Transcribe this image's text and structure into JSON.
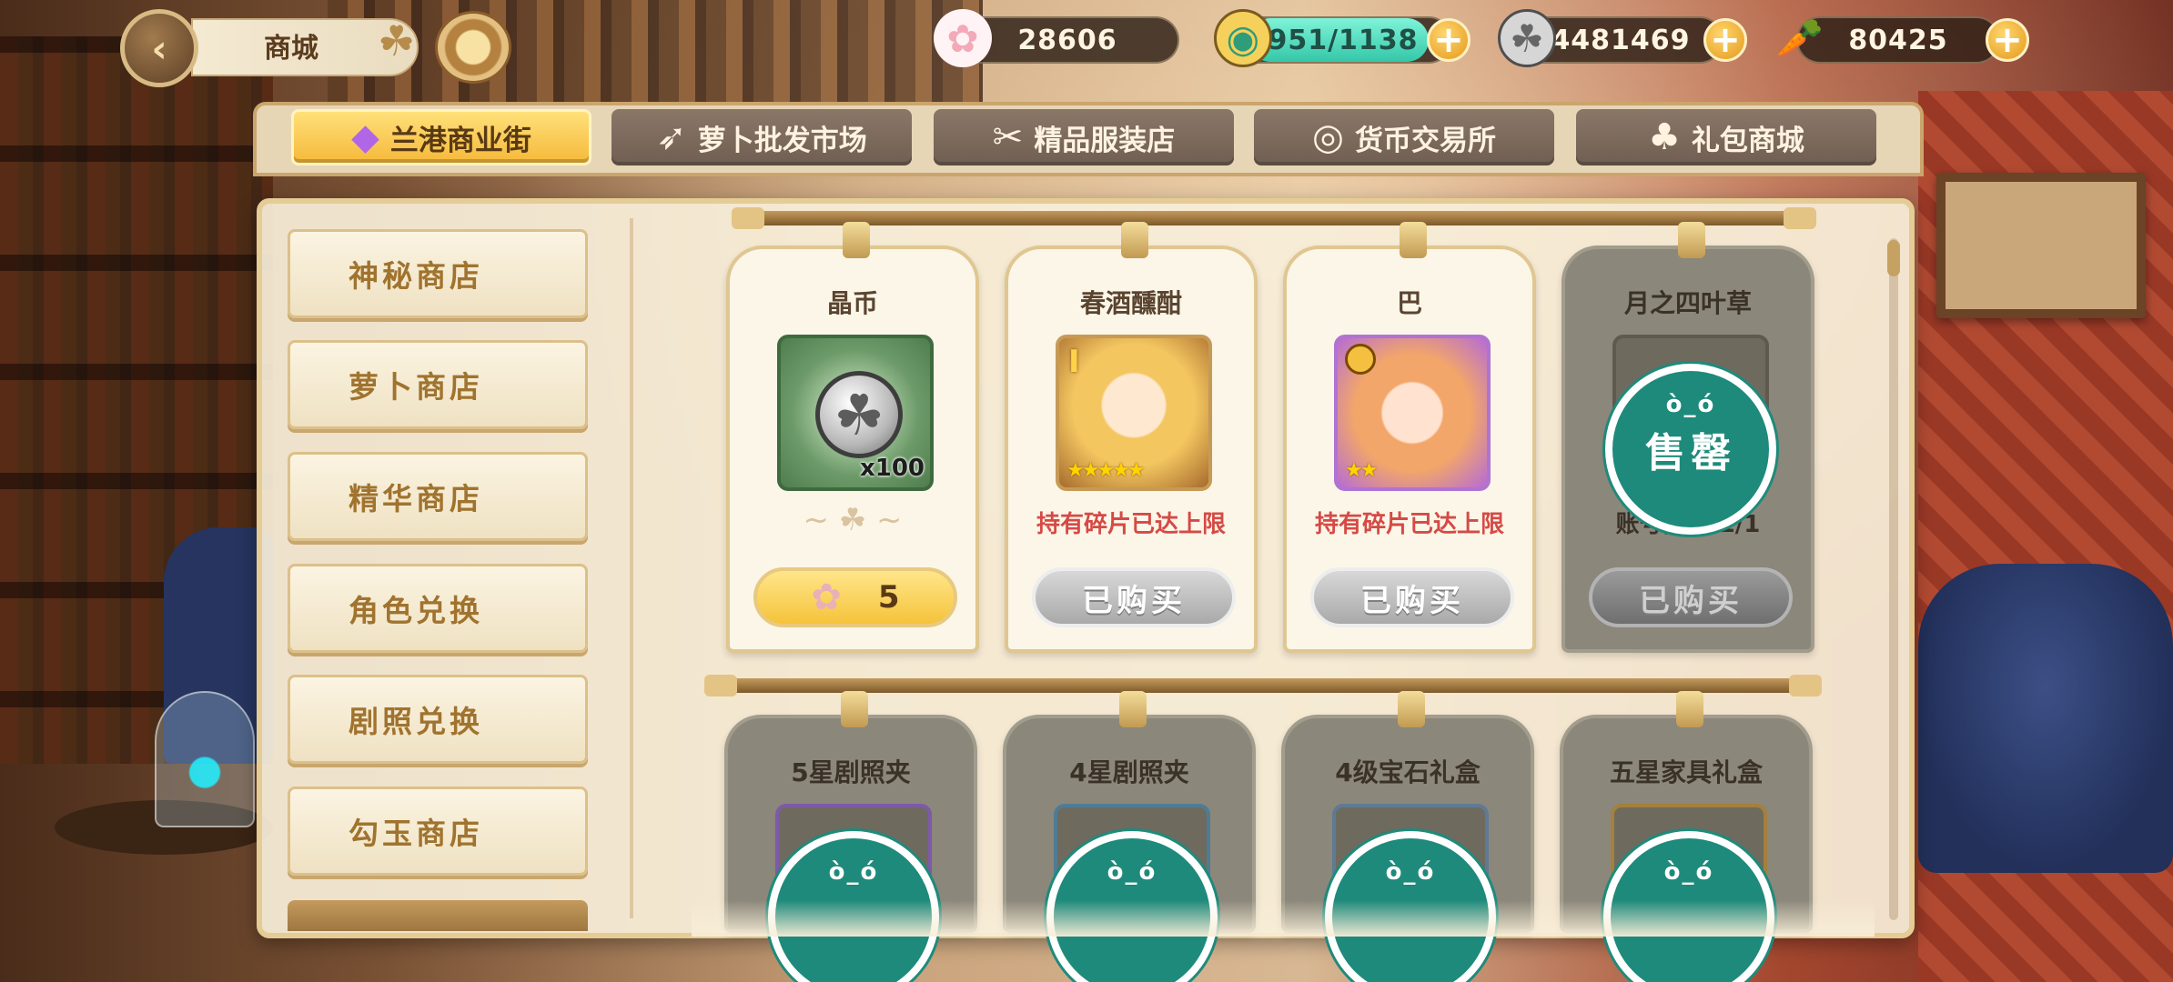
{
  "header": {
    "back_icon": "back-arrow-icon",
    "title": "商城"
  },
  "currencies": [
    {
      "name": "flower-currency",
      "icon": "sakura-icon",
      "value": "28606"
    },
    {
      "name": "stamina",
      "icon": "stamina-potion-icon",
      "value": "951/1138",
      "fill_ratio": 0.84
    },
    {
      "name": "crystal-coin",
      "icon": "clover-coin-icon",
      "value": "4481469"
    },
    {
      "name": "carrot",
      "icon": "carrot-icon",
      "value": "80425"
    }
  ],
  "tabs": [
    {
      "label": "兰港商业街",
      "icon": "crystal-icon",
      "active": true
    },
    {
      "label": "萝卜批发市场",
      "icon": "carrot-icon",
      "active": false
    },
    {
      "label": "精品服装店",
      "icon": "hanger-icon",
      "active": false
    },
    {
      "label": "货币交易所",
      "icon": "coin-icon",
      "active": false
    },
    {
      "label": "礼包商城",
      "icon": "gift-bag-icon",
      "active": false
    }
  ],
  "sidebar": {
    "items": [
      {
        "label": "神秘商店"
      },
      {
        "label": "萝卜商店"
      },
      {
        "label": "精华商店"
      },
      {
        "label": "角色兑换"
      },
      {
        "label": "剧照兑换"
      },
      {
        "label": "勾玉商店"
      }
    ]
  },
  "items_row1": [
    {
      "title": "晶币",
      "quantity": "x100",
      "price": "5",
      "price_icon": "sakura-icon"
    },
    {
      "title": "春酒醺酣",
      "note": "持有碎片已达上限",
      "status": "已购买",
      "rank": "I",
      "stars": 5
    },
    {
      "title": "巴",
      "note": "持有碎片已达上限",
      "status": "已购买",
      "stars": 2
    },
    {
      "title": "月之四叶草",
      "note": "账号限购 1/1",
      "status": "已购买",
      "stamp": "售罄"
    }
  ],
  "items_row2": [
    {
      "title": "5星剧照夹"
    },
    {
      "title": "4星剧照夹"
    },
    {
      "title": "4级宝石礼盒"
    },
    {
      "title": "五星家具礼盒"
    }
  ],
  "colors": {
    "accent_gold": "#f5b93a",
    "warning_red": "#d54a46",
    "soldout_green": "#1e8a7b"
  }
}
